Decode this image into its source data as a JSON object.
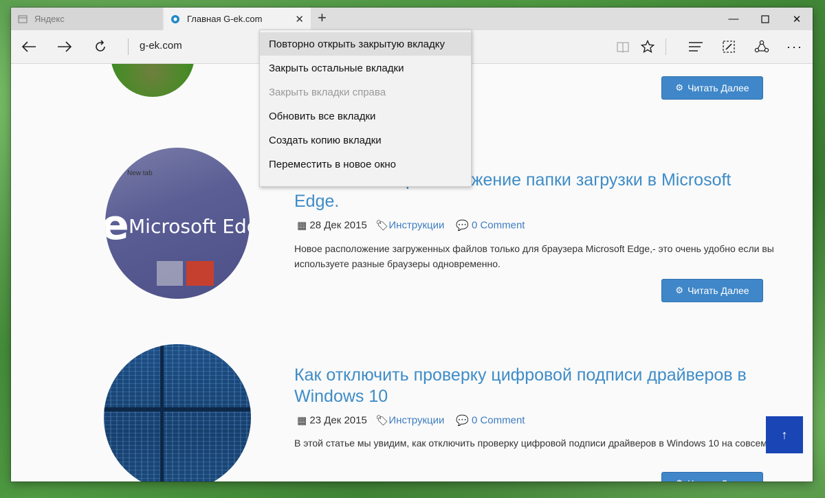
{
  "browser": {
    "tabs": [
      {
        "label": "Яндекс",
        "active": false
      },
      {
        "label": "Главная G-ek.com",
        "active": true
      }
    ],
    "address": "g-ek.com",
    "accent": "#3f87c9"
  },
  "context_menu": {
    "items": [
      {
        "label": "Повторно открыть закрытую вкладку",
        "state": "highlighted"
      },
      {
        "label": "Закрыть остальные вкладки",
        "state": "normal"
      },
      {
        "label": "Закрыть вкладки справа",
        "state": "disabled"
      },
      {
        "label": "Обновить все вкладки",
        "state": "normal"
      },
      {
        "label": "Создать копию вкладки",
        "state": "normal"
      },
      {
        "label": "Переместить в новое окно",
        "state": "normal"
      }
    ]
  },
  "page": {
    "read_more_label": "Читать Далее",
    "thumb2_tab_label": "New tab",
    "thumb2_logo_text": "Microsoft Edge",
    "articles": [
      {
        "title": "Как изменить расположение папки загрузки в Microsoft Edge.",
        "date": "28 Дек 2015",
        "category": "Инструкции",
        "comments": "0 Comment",
        "excerpt": "Новое расположение загруженных файлов только для браузера Microsoft Edge,- это очень удобно если вы используете разные браузеры одновременно."
      },
      {
        "title": "Как отключить проверку цифровой подписи драйверов в Windows 10",
        "date": "23 Дек 2015",
        "category": "Инструкции",
        "comments": "0 Comment",
        "excerpt": "В этой статье мы увидим, как отключить проверку цифровой подписи драйверов в Windows 10 на совсем."
      }
    ],
    "scroll_top_icon": "↑"
  }
}
